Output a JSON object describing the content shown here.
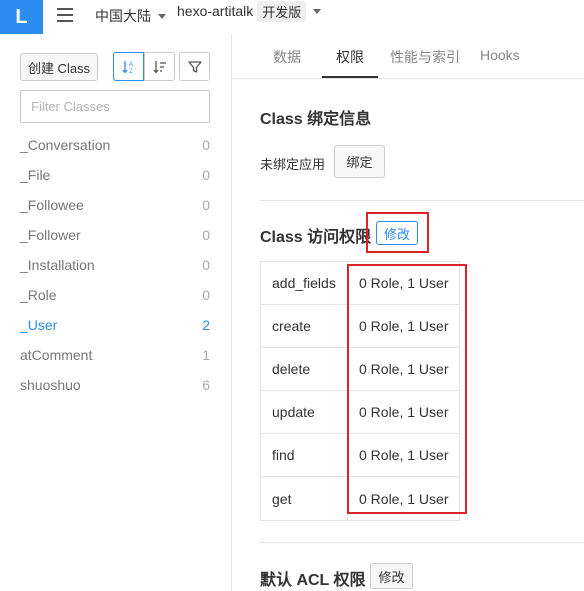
{
  "topbar": {
    "logo": "L",
    "region": "中国大陆",
    "app_name": "hexo-artitalk",
    "env_tag": "开发版"
  },
  "sidebar": {
    "create_button": "创建 Class",
    "filter_placeholder": "Filter Classes",
    "classes": [
      {
        "name": "_Conversation",
        "count": "0"
      },
      {
        "name": "_File",
        "count": "0"
      },
      {
        "name": "_Followee",
        "count": "0"
      },
      {
        "name": "_Follower",
        "count": "0"
      },
      {
        "name": "_Installation",
        "count": "0"
      },
      {
        "name": "_Role",
        "count": "0"
      },
      {
        "name": "_User",
        "count": "2"
      },
      {
        "name": "atComment",
        "count": "1"
      },
      {
        "name": "shuoshuo",
        "count": "6"
      }
    ],
    "active_class": "_User"
  },
  "tabs": [
    {
      "label": "数据"
    },
    {
      "label": "权限"
    },
    {
      "label": "性能与索引"
    },
    {
      "label": "Hooks"
    }
  ],
  "binding": {
    "title": "Class 绑定信息",
    "status": "未绑定应用",
    "bind_button": "绑定"
  },
  "access": {
    "title": "Class 访问权限",
    "edit_button": "修改",
    "rows": [
      {
        "op": "add_fields",
        "value": "0 Role, 1 User"
      },
      {
        "op": "create",
        "value": "0 Role, 1 User"
      },
      {
        "op": "delete",
        "value": "0 Role, 1 User"
      },
      {
        "op": "update",
        "value": "0 Role, 1 User"
      },
      {
        "op": "find",
        "value": "0 Role, 1 User"
      },
      {
        "op": "get",
        "value": "0 Role, 1 User"
      }
    ]
  },
  "default_acl": {
    "title": "默认 ACL 权限",
    "edit_button": "修改"
  },
  "colors": {
    "accent": "#2d8cf0",
    "highlight_box": "#d9232d"
  }
}
